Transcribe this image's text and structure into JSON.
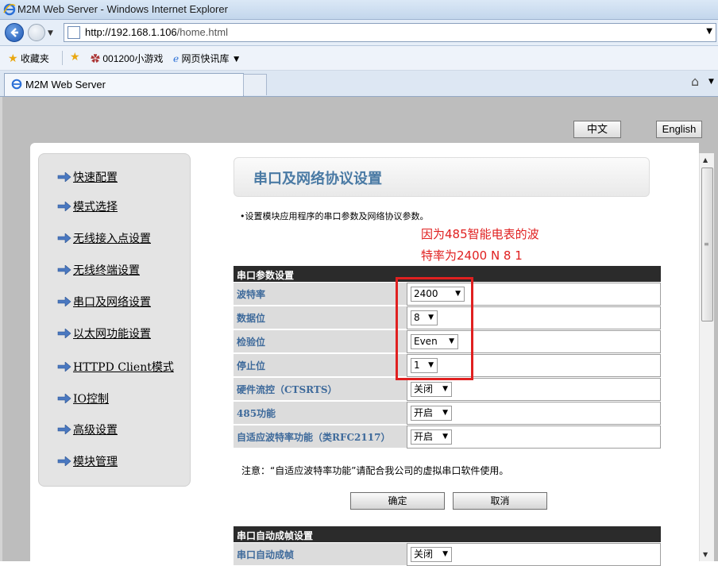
{
  "window": {
    "title": "M2M Web Server - Windows Internet Explorer"
  },
  "address": {
    "url_host": "http://192.168.1.106",
    "url_path": "/home.html"
  },
  "favorites": {
    "label": "收藏夹",
    "items": [
      "001200小游戏",
      "网页快讯库 ▼"
    ]
  },
  "tabs": [
    {
      "label": "M2M Web Server"
    }
  ],
  "lang": {
    "zh": "中文",
    "en": "English"
  },
  "menu": [
    "快速配置",
    "模式选择",
    "无线接入点设置",
    "无线终端设置",
    "串口及网络设置",
    "以太网功能设置",
    "HTTPD Client模式",
    "IO控制",
    "高级设置",
    "模块管理"
  ],
  "page": {
    "heading": "串口及网络协议设置",
    "description": "设置模块应用程序的串口参数及网络协议参数。",
    "annotation_line1": "因为485智能电表的波",
    "annotation_line2": "特率为2400 N 8 1",
    "section1": "串口参数设置",
    "rows": [
      {
        "label": "波特率",
        "value": "2400"
      },
      {
        "label": "数据位",
        "value": "8"
      },
      {
        "label": "检验位",
        "value": "Even"
      },
      {
        "label": "停止位",
        "value": "1"
      },
      {
        "label": "硬件流控（CTSRTS）",
        "value": "关闭"
      },
      {
        "label": "485功能",
        "value": "开启"
      },
      {
        "label": "自适应波特率功能（类RFC2117）",
        "value": "开启"
      }
    ],
    "note": "注意：“自适应波特率功能”请配合我公司的虚拟串口软件使用。",
    "confirm": "确定",
    "cancel": "取消",
    "section2": "串口自动成帧设置",
    "row_auto": {
      "label": "串口自动成帧",
      "value": "关闭"
    }
  },
  "colors": {
    "annotation": "#e02020",
    "label_text": "#3e6a9b",
    "heading_text": "#4a7aa4"
  }
}
